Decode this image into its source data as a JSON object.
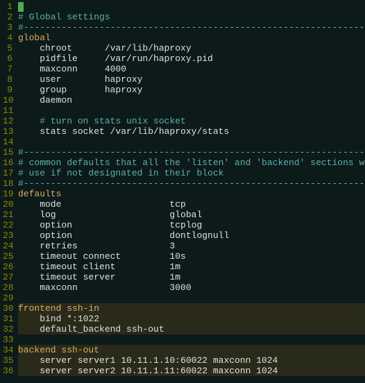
{
  "lines": [
    {
      "n": 1,
      "raw": "#",
      "style": "cursor"
    },
    {
      "n": 2,
      "raw": "# Global settings",
      "style": "comment"
    },
    {
      "n": 3,
      "raw": "#---------------------------------------------------------------------",
      "style": "comment"
    },
    {
      "n": 4,
      "raw": "global",
      "style": "section"
    },
    {
      "n": 5,
      "raw": "    chroot      /var/lib/haproxy",
      "style": "kv"
    },
    {
      "n": 6,
      "raw": "    pidfile     /var/run/haproxy.pid",
      "style": "kv"
    },
    {
      "n": 7,
      "raw": "    maxconn     4000",
      "style": "kv"
    },
    {
      "n": 8,
      "raw": "    user        haproxy",
      "style": "kv"
    },
    {
      "n": 9,
      "raw": "    group       haproxy",
      "style": "kv"
    },
    {
      "n": 10,
      "raw": "    daemon",
      "style": "kv"
    },
    {
      "n": 11,
      "raw": "",
      "style": "blank"
    },
    {
      "n": 12,
      "raw": "    # turn on stats unix socket",
      "style": "comment-indent"
    },
    {
      "n": 13,
      "raw": "    stats socket /var/lib/haproxy/stats",
      "style": "kv"
    },
    {
      "n": 14,
      "raw": "",
      "style": "blank"
    },
    {
      "n": 15,
      "raw": "#---------------------------------------------------------------------",
      "style": "comment"
    },
    {
      "n": 16,
      "raw": "# common defaults that all the 'listen' and 'backend' sections will",
      "style": "comment"
    },
    {
      "n": 17,
      "raw": "# use if not designated in their block",
      "style": "comment"
    },
    {
      "n": 18,
      "raw": "#---------------------------------------------------------------------",
      "style": "comment"
    },
    {
      "n": 19,
      "raw": "defaults",
      "style": "section"
    },
    {
      "n": 20,
      "raw": "    mode                    tcp",
      "style": "kv"
    },
    {
      "n": 21,
      "raw": "    log                     global",
      "style": "kv"
    },
    {
      "n": 22,
      "raw": "    option                  tcplog",
      "style": "kv"
    },
    {
      "n": 23,
      "raw": "    option                  dontlognull",
      "style": "kv"
    },
    {
      "n": 24,
      "raw": "    retries                 3",
      "style": "kv"
    },
    {
      "n": 25,
      "raw": "    timeout connect         10s",
      "style": "kv"
    },
    {
      "n": 26,
      "raw": "    timeout client          1m",
      "style": "kv"
    },
    {
      "n": 27,
      "raw": "    timeout server          1m",
      "style": "kv"
    },
    {
      "n": 28,
      "raw": "    maxconn                 3000",
      "style": "kv"
    },
    {
      "n": 29,
      "raw": "",
      "style": "blank"
    },
    {
      "n": 30,
      "raw": "frontend ssh-in",
      "style": "frontend"
    },
    {
      "n": 31,
      "raw": "    bind *:1022",
      "style": "frontend-kv"
    },
    {
      "n": 32,
      "raw": "    default_backend ssh-out",
      "style": "frontend-kv"
    },
    {
      "n": 33,
      "raw": "",
      "style": "blank"
    },
    {
      "n": 34,
      "raw": "backend ssh-out",
      "style": "frontend"
    },
    {
      "n": 35,
      "raw": "    server server1 10.11.1.10:60022 maxconn 1024",
      "style": "frontend-kv"
    },
    {
      "n": 36,
      "raw": "    server server2 10.11.1.11:60022 maxconn 1024",
      "style": "frontend-kv"
    }
  ],
  "colors": {
    "bg": "#0d1a1a",
    "gutter_fg": "#8a8a00",
    "comment": "#5fafaf",
    "section": "#d7af5f",
    "text": "#e0e0e0",
    "highlight_bg": "#2a2a1a",
    "cursor": "#4caf50"
  }
}
